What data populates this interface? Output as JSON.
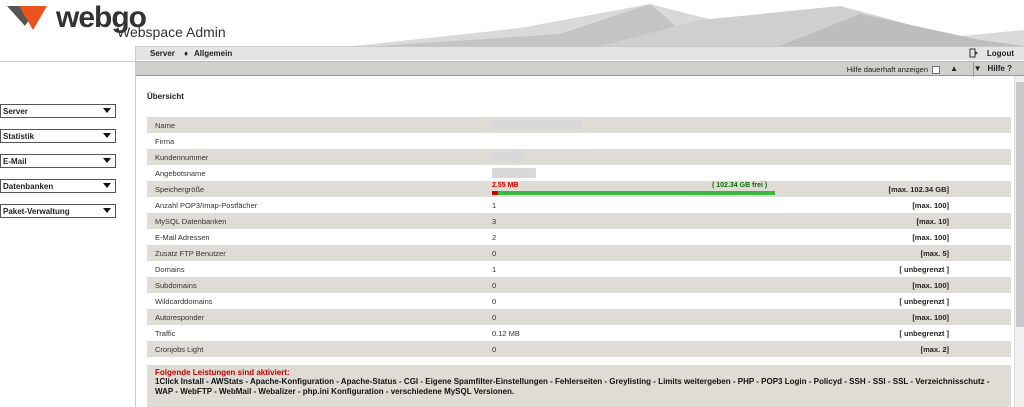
{
  "brand": {
    "name": "webgo",
    "subtitle": "Webspace Admin",
    "colors": {
      "logo_orange": "#e8531e",
      "logo_gray": "#555555"
    }
  },
  "topbar": {
    "breadcrumb": [
      "Server",
      "Allgemein"
    ],
    "separator": "♦",
    "logout_label": "Logout",
    "logout_icon": "logout-door-icon"
  },
  "helpbar": {
    "permanent_label": "Hilfe dauerhaft anzeigen",
    "help_label": "Hilfe ?"
  },
  "sidebar": {
    "items": [
      {
        "label": "Server"
      },
      {
        "label": "Statistik"
      },
      {
        "label": "E-Mail"
      },
      {
        "label": "Datenbanken"
      },
      {
        "label": "Paket-Verwaltung"
      }
    ]
  },
  "overview": {
    "title": "Übersicht",
    "rows": [
      {
        "name": "Name",
        "value": "",
        "max": ""
      },
      {
        "name": "Firma",
        "value": "",
        "max": ""
      },
      {
        "name": "Kundennummer",
        "value": "",
        "max": ""
      },
      {
        "name": "Angebotsname",
        "value": "",
        "max": ""
      },
      {
        "name": "Speichergröße",
        "value": "",
        "max": "[max. 102.34 GB]"
      },
      {
        "name": "Anzahl POP3/Imap-Postfächer",
        "value": "1",
        "max": "[max. 100]"
      },
      {
        "name": "MySQL Datenbanken",
        "value": "3",
        "max": "[max. 10]"
      },
      {
        "name": "E-Mail Adressen",
        "value": "2",
        "max": "[max. 100]"
      },
      {
        "name": "Zusatz FTP Benutzer",
        "value": "0",
        "max": "[max. 5]"
      },
      {
        "name": "Domains",
        "value": "1",
        "max": "[ unbegrenzt ]"
      },
      {
        "name": "Subdomains",
        "value": "0",
        "max": "[max. 100]"
      },
      {
        "name": "Wildcarddomains",
        "value": "0",
        "max": "[ unbegrenzt ]"
      },
      {
        "name": "Autoresponder",
        "value": "0",
        "max": "[max. 100]"
      },
      {
        "name": "Traffic",
        "value": "0.12 MB",
        "max": "[ unbegrenzt ]"
      },
      {
        "name": "Cronjobs Light",
        "value": "0",
        "max": "[max. 2]"
      }
    ],
    "storage": {
      "used_label": "2.55 MB",
      "free_label": "( 102.34 GB frei )",
      "used_fraction": 0.02
    }
  },
  "services": {
    "lead": "Folgende Leistungen sind aktiviert:",
    "list": "1Click Install - AWStats - Apache-Konfiguration - Apache-Status - CGI - Eigene Spamfilter-Einstellungen - Fehlerseiten - Greylisting - Limits weitergeben - PHP - POP3 Login - Policyd - SSH - SSI - SSL - Verzeichnisschutz - WAP - WebFTP - WebMail - Webalizer - php.ini Konfiguration - verschiedene MySQL Versionen."
  }
}
